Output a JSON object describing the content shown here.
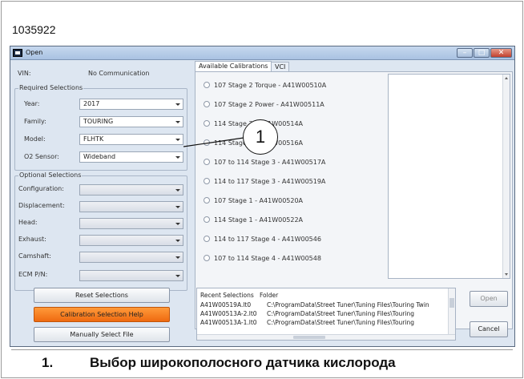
{
  "figure_id": "1035922",
  "window": {
    "title": "Open"
  },
  "vin": {
    "label": "VIN:",
    "value": "No Communication"
  },
  "required": {
    "title": "Required Selections",
    "fields": [
      {
        "label": "Year:",
        "value": "2017"
      },
      {
        "label": "Family:",
        "value": "TOURING"
      },
      {
        "label": "Model:",
        "value": "FLHTK"
      },
      {
        "label": "O2 Sensor:",
        "value": "Wideband"
      }
    ]
  },
  "optional": {
    "title": "Optional Selections",
    "fields": [
      {
        "label": "Configuration:",
        "value": ""
      },
      {
        "label": "Displacement:",
        "value": ""
      },
      {
        "label": "Head:",
        "value": ""
      },
      {
        "label": "Exhaust:",
        "value": ""
      },
      {
        "label": "Camshaft:",
        "value": ""
      },
      {
        "label": "ECM P/N:",
        "value": ""
      }
    ]
  },
  "buttons": {
    "reset": "Reset Selections",
    "help": "Calibration Selection Help",
    "manual": "Manually Select File",
    "open": "Open",
    "cancel": "Cancel"
  },
  "tabs": [
    "Available Calibrations",
    "VCI"
  ],
  "calibrations": [
    "107 Stage 2 Torque - A41W00510A",
    "107 Stage 2 Power - A41W00511A",
    "114 Stage 2 - A41W00514A",
    "114 Stage 2 - A41W00516A",
    "107 to 114 Stage 3 - A41W00517A",
    "114 to 117 Stage 3 - A41W00519A",
    "107 Stage 1 - A41W00520A",
    "114 Stage 1 - A41W00522A",
    "114 to 117 Stage 4 - A41W00546",
    "107 to 114 Stage 4 - A41W00548"
  ],
  "recent": {
    "headers": [
      "Recent Selections",
      "Folder"
    ],
    "rows": [
      [
        "A41W00519A.lt0",
        "C:\\ProgramData\\Street Tuner\\Tuning Files\\Touring Twin"
      ],
      [
        "A41W00513A-2.lt0",
        "C:\\ProgramData\\Street Tuner\\Tuning Files\\Touring"
      ],
      [
        "A41W00513A-1.lt0",
        "C:\\ProgramData\\Street Tuner\\Tuning Files\\Touring"
      ]
    ]
  },
  "callout": "1",
  "caption": {
    "number": "1.",
    "text": "Выбор широкополосного датчика кислорода"
  }
}
